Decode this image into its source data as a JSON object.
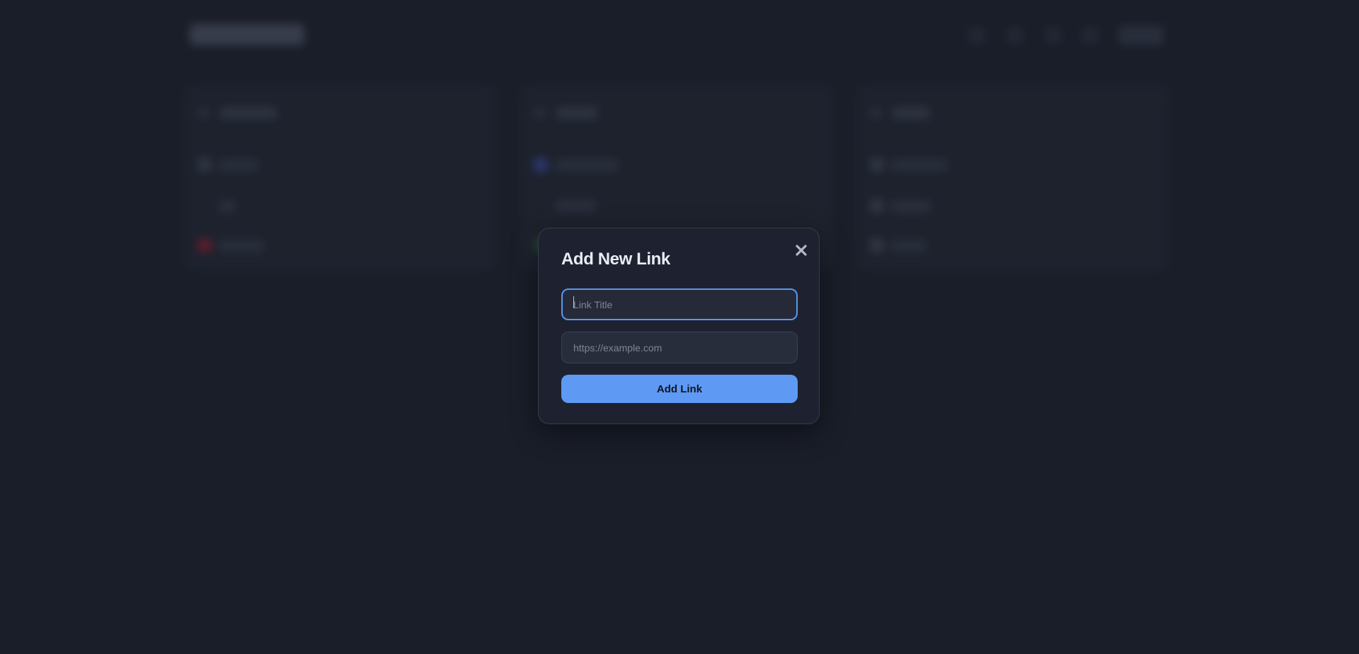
{
  "modal": {
    "title": "Add New Link",
    "close_icon": "close-icon",
    "title_field": {
      "value": "",
      "placeholder": "Link Title"
    },
    "url_field": {
      "value": "",
      "placeholder": "https://example.com"
    },
    "submit_label": "Add Link"
  },
  "colors": {
    "page_background": "#1a1e29",
    "modal_background": "#1e2230",
    "accent": "#5e9af4",
    "focus_ring": "#5b97f2"
  }
}
